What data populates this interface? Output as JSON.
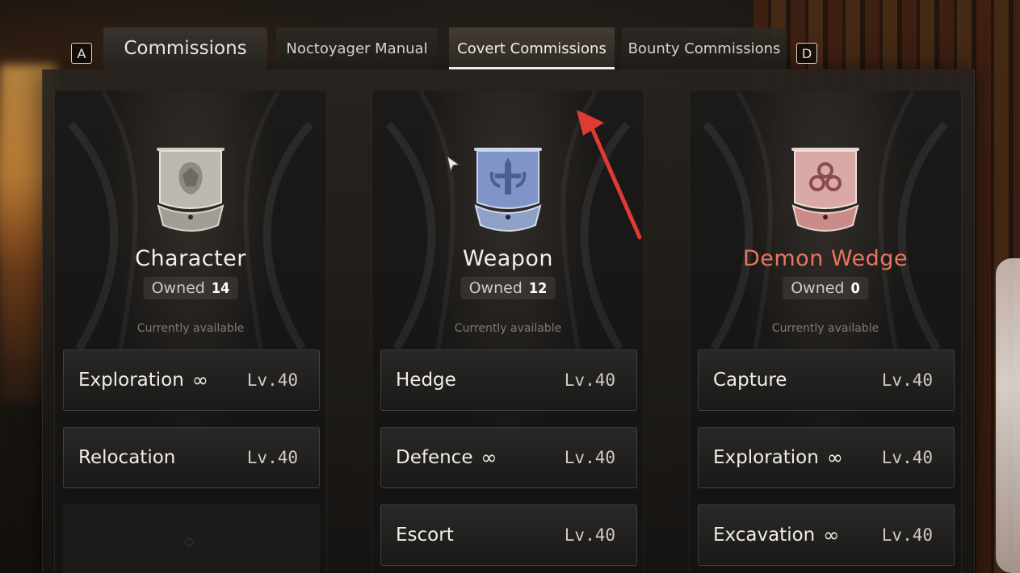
{
  "tabs": {
    "key_prev": "A",
    "key_next": "D",
    "items": [
      {
        "label": "Commissions"
      },
      {
        "label": "Noctoyager Manual"
      },
      {
        "label": "Covert Commissions"
      },
      {
        "label": "Bounty Commissions"
      }
    ],
    "active": "Covert Commissions"
  },
  "cards": [
    {
      "title": "Character",
      "title_color": "#f3f0ea",
      "owned_label": "Owned",
      "owned_count": "14",
      "availability": "Currently available",
      "emblem": "character-emblem-icon",
      "entries": [
        {
          "name": "Exploration",
          "infinite": "∞",
          "level": "Lv.40"
        },
        {
          "name": "Relocation",
          "infinite": "",
          "level": "Lv.40"
        }
      ]
    },
    {
      "title": "Weapon",
      "title_color": "#f3f0ea",
      "owned_label": "Owned",
      "owned_count": "12",
      "availability": "Currently available",
      "emblem": "weapon-emblem-icon",
      "entries": [
        {
          "name": "Hedge",
          "infinite": "",
          "level": "Lv.40"
        },
        {
          "name": "Defence",
          "infinite": "∞",
          "level": "Lv.40"
        },
        {
          "name": "Escort",
          "infinite": "",
          "level": "Lv.40"
        }
      ]
    },
    {
      "title": "Demon Wedge",
      "title_color": "#e8765e",
      "owned_label": "Owned",
      "owned_count": "0",
      "availability": "Currently available",
      "emblem": "demon-wedge-emblem-icon",
      "entries": [
        {
          "name": "Capture",
          "infinite": "",
          "level": "Lv.40"
        },
        {
          "name": "Exploration",
          "infinite": "∞",
          "level": "Lv.40"
        },
        {
          "name": "Excavation",
          "infinite": "∞",
          "level": "Lv.40"
        }
      ]
    }
  ],
  "colors": {
    "accent_red": "#e03a35",
    "weapon_emblem": "#7f95c8",
    "demon_emblem": "#d99a96",
    "character_emblem": "#bdb8b0"
  }
}
